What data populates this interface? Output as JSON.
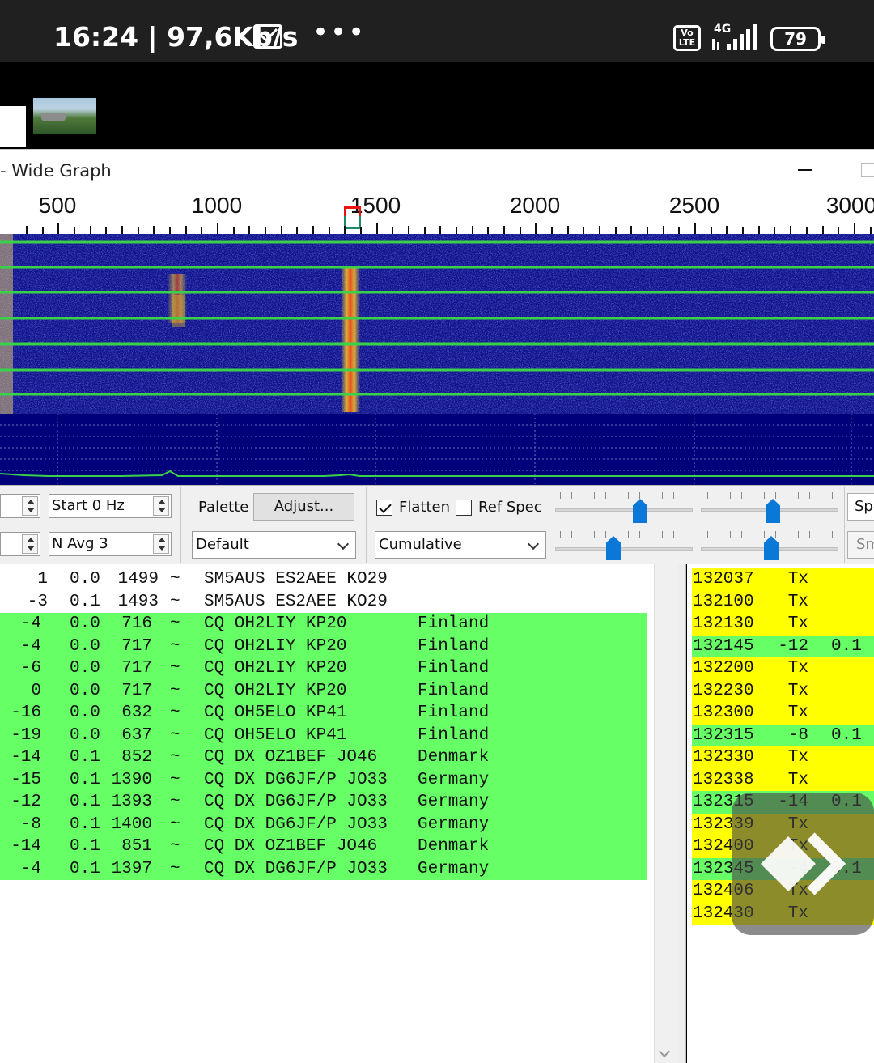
{
  "status_bar": {
    "time": "16:24",
    "speed": "97,6Kb/s",
    "network": "4G",
    "volte": "Vo\nLTE",
    "battery": "79"
  },
  "window": {
    "title": "- Wide Graph"
  },
  "frequency_scale": {
    "labels": [
      "500",
      "1000",
      "1500",
      "2000",
      "2500",
      "3000"
    ]
  },
  "controls": {
    "bins_label": "",
    "start_label": "Start 0 Hz",
    "navg_label": "N Avg 3",
    "palette_label": "Palette",
    "adjust_button": "Adjust...",
    "palette_value": "Default",
    "flatten_label": "Flatten",
    "flatten_checked": true,
    "refspec_label": "Ref Spec",
    "refspec_checked": false,
    "spectrum_value": "Cumulative",
    "right_button_1": "Spe",
    "right_button_2": "Sm"
  },
  "band_activity": {
    "rows": [
      {
        "db": "1",
        "dt": "0.0",
        "freq": "1499",
        "sep": "~",
        "msg": "SM5AUS ES2AEE KO29",
        "country": "",
        "highlight": "plain"
      },
      {
        "db": "-3",
        "dt": "0.1",
        "freq": "1493",
        "sep": "~",
        "msg": "SM5AUS ES2AEE KO29",
        "country": "",
        "highlight": "plain"
      },
      {
        "db": "-4",
        "dt": "0.0",
        "freq": "716",
        "sep": "~",
        "msg": "CQ OH2LIY KP20",
        "country": "Finland",
        "highlight": "green"
      },
      {
        "db": "-4",
        "dt": "0.0",
        "freq": "717",
        "sep": "~",
        "msg": "CQ OH2LIY KP20",
        "country": "Finland",
        "highlight": "green"
      },
      {
        "db": "-6",
        "dt": "0.0",
        "freq": "717",
        "sep": "~",
        "msg": "CQ OH2LIY KP20",
        "country": "Finland",
        "highlight": "green"
      },
      {
        "db": "0",
        "dt": "0.0",
        "freq": "717",
        "sep": "~",
        "msg": "CQ OH2LIY KP20",
        "country": "Finland",
        "highlight": "green"
      },
      {
        "db": "-16",
        "dt": "0.0",
        "freq": "632",
        "sep": "~",
        "msg": "CQ OH5ELO KP41",
        "country": "Finland",
        "highlight": "green"
      },
      {
        "db": "-19",
        "dt": "0.0",
        "freq": "637",
        "sep": "~",
        "msg": "CQ OH5ELO KP41",
        "country": "Finland",
        "highlight": "green"
      },
      {
        "db": "-14",
        "dt": "0.1",
        "freq": "852",
        "sep": "~",
        "msg": "CQ DX OZ1BEF JO46",
        "country": "Denmark",
        "highlight": "green"
      },
      {
        "db": "-15",
        "dt": "0.1",
        "freq": "1390",
        "sep": "~",
        "msg": "CQ DX DG6JF/P JO33",
        "country": "Germany",
        "highlight": "green"
      },
      {
        "db": "-12",
        "dt": "0.1",
        "freq": "1393",
        "sep": "~",
        "msg": "CQ DX DG6JF/P JO33",
        "country": "Germany",
        "highlight": "green"
      },
      {
        "db": "-8",
        "dt": "0.1",
        "freq": "1400",
        "sep": "~",
        "msg": "CQ DX DG6JF/P JO33",
        "country": "Germany",
        "highlight": "green"
      },
      {
        "db": "-14",
        "dt": "0.1",
        "freq": "851",
        "sep": "~",
        "msg": "CQ DX OZ1BEF JO46",
        "country": "Denmark",
        "highlight": "green"
      },
      {
        "db": "-4",
        "dt": "0.1",
        "freq": "1397",
        "sep": "~",
        "msg": "CQ DX DG6JF/P JO33",
        "country": "Germany",
        "highlight": "green"
      }
    ]
  },
  "rx_frequency": {
    "rows": [
      {
        "time": "132037",
        "c2": "Tx",
        "c3": "",
        "highlight": "yellow"
      },
      {
        "time": "132100",
        "c2": "Tx",
        "c3": "",
        "highlight": "yellow"
      },
      {
        "time": "132130",
        "c2": "Tx",
        "c3": "",
        "highlight": "yellow"
      },
      {
        "time": "132145",
        "c2": "-12",
        "c3": "0.1",
        "highlight": "green"
      },
      {
        "time": "132200",
        "c2": "Tx",
        "c3": "",
        "highlight": "yellow"
      },
      {
        "time": "132230",
        "c2": "Tx",
        "c3": "",
        "highlight": "yellow"
      },
      {
        "time": "132300",
        "c2": "Tx",
        "c3": "",
        "highlight": "yellow"
      },
      {
        "time": "132315",
        "c2": "-8",
        "c3": "0.1",
        "highlight": "green"
      },
      {
        "time": "132330",
        "c2": "Tx",
        "c3": "",
        "highlight": "yellow"
      },
      {
        "time": "132338",
        "c2": "Tx",
        "c3": "",
        "highlight": "yellow"
      },
      {
        "time": "132315",
        "c2": "-14",
        "c3": "0.1",
        "highlight": "green"
      },
      {
        "time": "132339",
        "c2": "Tx",
        "c3": "",
        "highlight": "yellow"
      },
      {
        "time": "132400",
        "c2": "Tx",
        "c3": "",
        "highlight": "yellow"
      },
      {
        "time": "132345",
        "c2": "-4",
        "c3": "0.1",
        "highlight": "green"
      },
      {
        "time": "132406",
        "c2": "Tx",
        "c3": "",
        "highlight": "yellow"
      },
      {
        "time": "132430",
        "c2": "Tx",
        "c3": "",
        "highlight": "yellow"
      }
    ]
  },
  "colors": {
    "decode_highlight_green": "#66ff66",
    "tx_highlight_yellow": "#ffff00",
    "waterfall_background": "#14148c",
    "period_line_green": "#2ecc40",
    "slider_thumb": "#0a78d7"
  },
  "icons": {
    "floating_overlay": "double-chevron-right-icon"
  }
}
